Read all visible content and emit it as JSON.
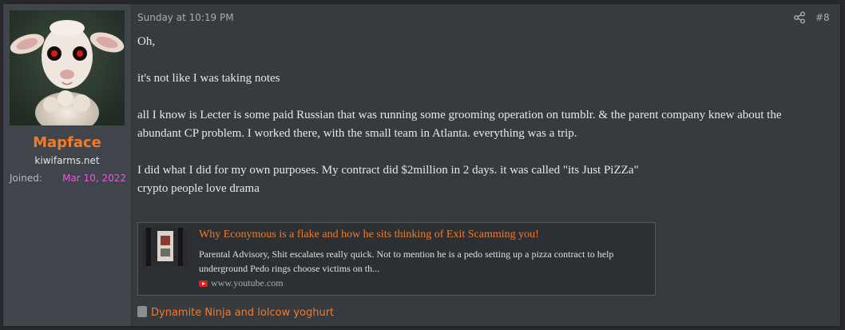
{
  "user": {
    "name": "Mapface",
    "title": "kiwifarms.net",
    "joined_label": "Joined:",
    "joined_date": "Mar 10, 2022",
    "avatar_icon": "lamb-avatar"
  },
  "post": {
    "date": "Sunday at 10:19 PM",
    "number": "#8",
    "share_icon": "share-icon",
    "paragraphs": [
      "Oh,",
      "it's not like I was taking notes",
      "all I know is Lecter is some paid Russian that was running some grooming operation on tumblr. & the parent company knew about the abundant CP problem. I worked there, with the small team in Atlanta. everything was a trip.",
      "I did what I did for my own purposes. My contract did $2million in 2 days. it was called \"its Just PiZZa\"",
      "crypto people love drama"
    ]
  },
  "embed": {
    "title": "Why Econymous is a flake and how he sits thinking of Exit Scamming you!",
    "description": "Parental Advisory, Shit escalates really quick. Not to mention he is a pedo setting up a pizza contract to help underground Pedo rings choose victims on th...",
    "domain": "www.youtube.com",
    "domain_icon": "youtube-icon"
  },
  "signature": {
    "text": "Dynamite Ninja and lolcow yoghurt",
    "icon": "reaction-icon"
  },
  "colors": {
    "accent": "#f27b29",
    "joined_date": "#e05cd8",
    "post_bg": "#373a3e",
    "user_bg": "#40454b"
  }
}
